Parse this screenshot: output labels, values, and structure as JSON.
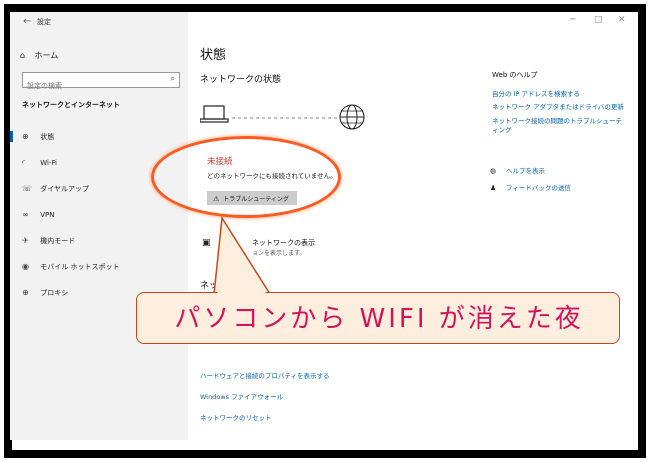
{
  "window": {
    "title": "設定",
    "back_glyph": "←",
    "controls": [
      "─",
      "□",
      "✕"
    ]
  },
  "sidebar": {
    "home_label": "ホーム",
    "search_placeholder": "設定の検索",
    "section_title": "ネットワークとインターネット",
    "items": [
      {
        "label": "状態",
        "icon": "status-icon",
        "active": true
      },
      {
        "label": "Wi-Fi",
        "icon": "wifi-icon",
        "active": false
      },
      {
        "label": "ダイヤルアップ",
        "icon": "dialup-icon",
        "active": false
      },
      {
        "label": "VPN",
        "icon": "vpn-icon",
        "active": false
      },
      {
        "label": "機内モード",
        "icon": "airplane-icon",
        "active": false
      },
      {
        "label": "モバイル ホットスポット",
        "icon": "hotspot-icon",
        "active": false
      },
      {
        "label": "プロキシ",
        "icon": "globe-icon",
        "active": false
      }
    ]
  },
  "main": {
    "title": "状態",
    "network_status_heading": "ネットワークの状態",
    "status_title": "未接続",
    "status_description": "どのネットワークにも接続されていません。",
    "troubleshoot_button": "トラブルシューティング",
    "partial_network_title": "ネットワークの表示",
    "partial_network_sub": "ョンを表示します。",
    "partial_heading": "ネッ",
    "links": [
      "ハードウェアと接続のプロパティを表示する",
      "Windows ファイアウォール",
      "ネットワークのリセット"
    ]
  },
  "help": {
    "title": "Web のヘルプ",
    "links": [
      "自分の IP アドレスを検索する",
      "ネットワーク アダプタまたはドライバの更新",
      "ネットワーク接続の問題のトラブルシューティング"
    ],
    "actions": [
      {
        "label": "ヘルプを表示",
        "icon": "chat-help-icon"
      },
      {
        "label": "フィードバックの送信",
        "icon": "feedback-icon"
      }
    ]
  },
  "overlay": {
    "callout_text": "パソコンから WIFI が消えた夜",
    "highlight_color": "#ff5a1f",
    "callout_text_color": "#d4145a"
  }
}
